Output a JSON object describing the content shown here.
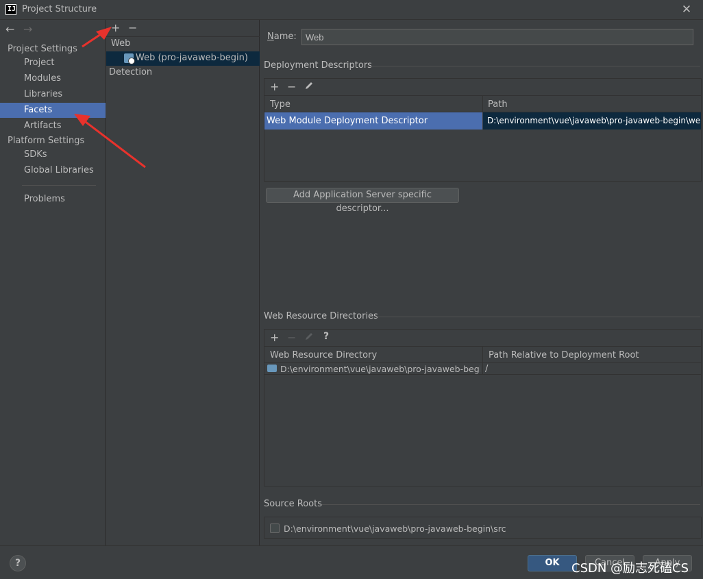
{
  "window": {
    "title": "Project Structure",
    "logo_text": "IJ"
  },
  "nav": {
    "back": "←",
    "forward": "→",
    "sections": [
      {
        "label": "Project Settings"
      },
      {
        "label": "Platform Settings"
      }
    ],
    "items": [
      {
        "label": "Project"
      },
      {
        "label": "Modules"
      },
      {
        "label": "Libraries"
      },
      {
        "label": "Facets"
      },
      {
        "label": "Artifacts"
      },
      {
        "label": "SDKs"
      },
      {
        "label": "Global Libraries"
      },
      {
        "label": "Problems"
      }
    ],
    "selected": "Facets"
  },
  "middle": {
    "add": "+",
    "remove": "−",
    "group": "Web",
    "facet": "Web (pro-javaweb-begin)",
    "detection": "Detection"
  },
  "main": {
    "name_label": "Name:",
    "name_value": "Web",
    "deployment": {
      "title": "Deployment Descriptors",
      "toolbar": {
        "add": "+",
        "remove": "−"
      },
      "columns": [
        "Type",
        "Path"
      ],
      "rows": [
        {
          "type": "Web Module Deployment Descriptor",
          "path": "D:\\environment\\vue\\javaweb\\pro-javaweb-begin\\web\\"
        }
      ],
      "add_server_button": "Add Application Server specific descriptor..."
    },
    "web_resources": {
      "title": "Web Resource Directories",
      "toolbar": {
        "add": "+",
        "remove": "−",
        "help": "?"
      },
      "columns": [
        "Web Resource Directory",
        "Path Relative to Deployment Root"
      ],
      "rows": [
        {
          "dir": "D:\\environment\\vue\\javaweb\\pro-javaweb-begin...",
          "rel": "/"
        }
      ]
    },
    "source_roots": {
      "title": "Source Roots",
      "items": [
        {
          "path": "D:\\environment\\vue\\javaweb\\pro-javaweb-begin\\src",
          "checked": false
        }
      ]
    }
  },
  "footer": {
    "help": "?",
    "ok": "OK",
    "cancel": "Cancel",
    "apply": "Apply",
    "watermark": "CSDN @励志死磕CS"
  },
  "colors": {
    "background": "#3c3f41",
    "selection": "#4b6eaf",
    "ok_button": "#365880",
    "annotation_arrow": "#e8322c"
  }
}
